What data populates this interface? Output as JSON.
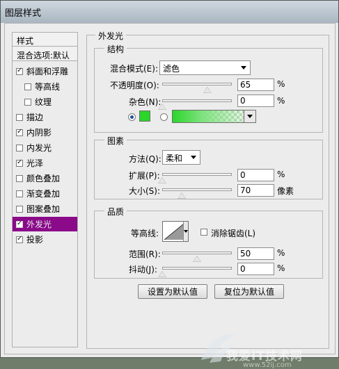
{
  "window": {
    "title": "图层样式"
  },
  "sidebar": {
    "header_styles": "样式",
    "header_blend": "混合选项:默认",
    "items": [
      {
        "label": "斜面和浮雕",
        "checked": true,
        "indent": false,
        "selected": false
      },
      {
        "label": "等高线",
        "checked": false,
        "indent": true,
        "selected": false
      },
      {
        "label": "纹理",
        "checked": false,
        "indent": true,
        "selected": false
      },
      {
        "label": "描边",
        "checked": false,
        "indent": false,
        "selected": false
      },
      {
        "label": "内阴影",
        "checked": true,
        "indent": false,
        "selected": false
      },
      {
        "label": "内发光",
        "checked": false,
        "indent": false,
        "selected": false
      },
      {
        "label": "光泽",
        "checked": true,
        "indent": false,
        "selected": false
      },
      {
        "label": "颜色叠加",
        "checked": false,
        "indent": false,
        "selected": false
      },
      {
        "label": "渐变叠加",
        "checked": false,
        "indent": false,
        "selected": false
      },
      {
        "label": "图案叠加",
        "checked": false,
        "indent": false,
        "selected": false
      },
      {
        "label": "外发光",
        "checked": true,
        "indent": false,
        "selected": true
      },
      {
        "label": "投影",
        "checked": true,
        "indent": false,
        "selected": false
      }
    ]
  },
  "panel": {
    "title": "外发光",
    "structure": {
      "legend": "结构",
      "blend_mode_label": "混合模式(E):",
      "blend_mode_value": "滤色",
      "opacity_label": "不透明度(O):",
      "opacity_value": "65",
      "opacity_unit": "%",
      "opacity_level": 0.65,
      "noise_label": "杂色(N):",
      "noise_value": "0",
      "noise_unit": "%",
      "noise_level": 0,
      "glow_color": "#2bd62b"
    },
    "elements": {
      "legend": "图素",
      "technique_label": "方法(Q):",
      "technique_value": "柔和",
      "spread_label": "扩展(P):",
      "spread_value": "0",
      "spread_unit": "%",
      "spread_level": 0,
      "size_label": "大小(S):",
      "size_value": "70",
      "size_unit": "像素",
      "size_level": 0.28
    },
    "quality": {
      "legend": "品质",
      "contour_label": "等高线:",
      "antialias_label": "消除锯齿(L)",
      "antialias_checked": false,
      "range_label": "范围(R):",
      "range_value": "50",
      "range_unit": "%",
      "range_level": 0.5,
      "jitter_label": "抖动(J):",
      "jitter_value": "0",
      "jitter_unit": "%",
      "jitter_level": 0
    },
    "buttons": {
      "make_default": "设置为默认值",
      "reset_default": "复位为默认值"
    }
  },
  "watermark": {
    "text": "我爱IT技术网",
    "url": "www.52ij.com"
  }
}
